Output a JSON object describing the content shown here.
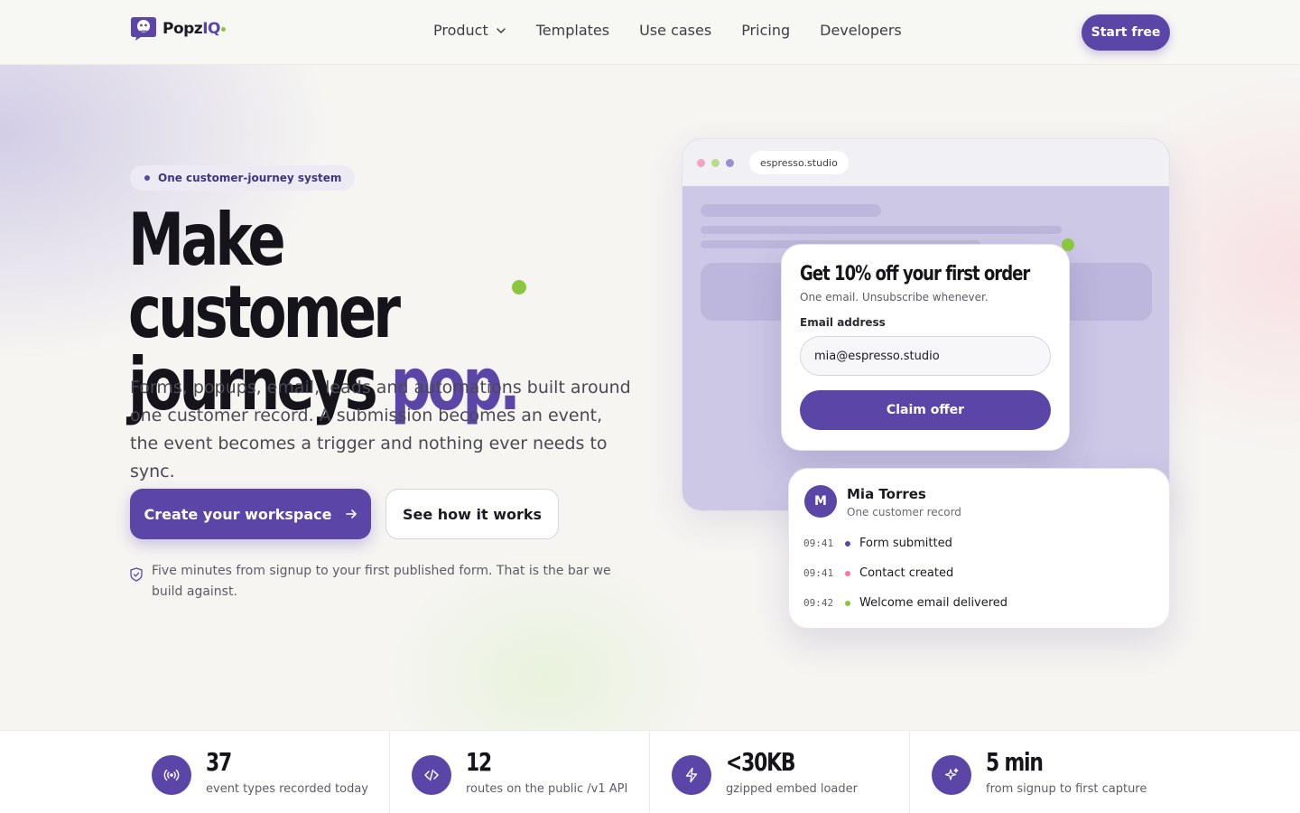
{
  "brand": {
    "name_part1": "Popz",
    "name_part2": "IQ",
    "accent": "#5b46a8",
    "accent_green": "#8cc63f"
  },
  "nav": {
    "links": [
      "Product",
      "Templates",
      "Use cases",
      "Pricing",
      "Developers"
    ],
    "cta": "Start free"
  },
  "hero": {
    "pill": "One customer-journey system",
    "headline_line1": "Make customer",
    "headline_line2_plain": "journeys ",
    "headline_line2_accent": "pop.",
    "subtext": "Forms, popups, email, leads and automations built around one customer record. A submission becomes an event, the event becomes a trigger and nothing ever needs to sync.",
    "primary_cta": "Create your workspace",
    "secondary_cta": "See how it works",
    "note": "Five minutes from signup to your first published form. That is the bar we build against."
  },
  "mockup": {
    "url": "espresso.studio",
    "popup": {
      "title": "Get 10% off your first order",
      "subtitle": "One email. Unsubscribe whenever.",
      "field_label": "Email address",
      "field_value": "mia@espresso.studio",
      "button": "Claim offer"
    },
    "record": {
      "avatar_initial": "M",
      "name": "Mia Torres",
      "subtitle": "One customer record",
      "events": [
        {
          "time": "09:41",
          "label": "Form submitted",
          "color": "#5b46a8"
        },
        {
          "time": "09:41",
          "label": "Contact created",
          "color": "#f07aa0"
        },
        {
          "time": "09:42",
          "label": "Welcome email delivered",
          "color": "#8cc63f"
        }
      ]
    }
  },
  "stats": [
    {
      "icon": "broadcast-icon",
      "value": "37",
      "label": "event types recorded today"
    },
    {
      "icon": "code-icon",
      "value": "12",
      "label": "routes on the public /v1 API"
    },
    {
      "icon": "bolt-icon",
      "value": "<30KB",
      "label": "gzipped embed loader"
    },
    {
      "icon": "sparkles-icon",
      "value": "5 min",
      "label": "from signup to first capture"
    }
  ]
}
